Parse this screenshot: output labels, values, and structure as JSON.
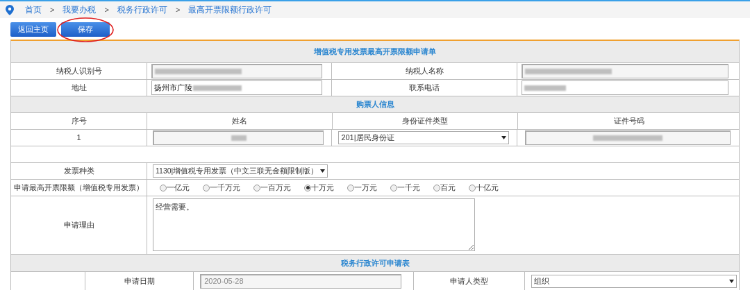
{
  "breadcrumb": [
    {
      "label": "首页"
    },
    {
      "separator": ">",
      "label": "我要办税"
    },
    {
      "separator": ">",
      "label": "税务行政许可"
    },
    {
      "separator": ">",
      "label": "最高开票限额行政许可"
    }
  ],
  "buttons": [
    {
      "label": "返回主页",
      "circled": false
    },
    {
      "label": "保存",
      "circled": true
    }
  ],
  "form_title": "增值税专用发票最高开票限额申请单",
  "taxpayer_rows": [
    [
      {
        "label": "纳税人识别号",
        "readonly": true,
        "redacted": true
      },
      {
        "label": "纳税人名称",
        "readonly": true,
        "redacted": true
      }
    ],
    [
      {
        "label": "地址",
        "value": "扬州市广陵",
        "readonly": false,
        "redacted": true
      },
      {
        "label": "联系电话",
        "readonly": false,
        "redacted": true
      }
    ]
  ],
  "buyer_section": {
    "title": "购票人信息",
    "columns": [
      "序号",
      "姓名",
      "身份证件类型",
      "证件号码"
    ],
    "rows": [
      {
        "index": "1",
        "id_type": "201|居民身份证",
        "name_redacted": true,
        "id_number_redacted": true
      }
    ]
  },
  "invoice_type": {
    "label": "发票种类",
    "value": "1130|增值税专用发票（中文三联无金额限制版）"
  },
  "limit": {
    "label": "申请最高开票限额（增值税专用发票）",
    "options": [
      {
        "label": "一亿元",
        "selected": false
      },
      {
        "label": "一千万元",
        "selected": false
      },
      {
        "label": "一百万元",
        "selected": false
      },
      {
        "label": "十万元",
        "selected": true
      },
      {
        "label": "一万元",
        "selected": false
      },
      {
        "label": "一千元",
        "selected": false
      },
      {
        "label": "百元",
        "selected": false
      },
      {
        "label": "十亿元",
        "selected": false
      }
    ]
  },
  "reason": {
    "label": "申请理由",
    "value": "经营需要。"
  },
  "permit_section": {
    "title": "税务行政许可申请表",
    "fields": [
      {
        "label": "申请日期",
        "value": "2020-05-28",
        "kind": "readonly"
      },
      {
        "label": "申请人类型",
        "value": "组织",
        "kind": "select"
      }
    ]
  }
}
